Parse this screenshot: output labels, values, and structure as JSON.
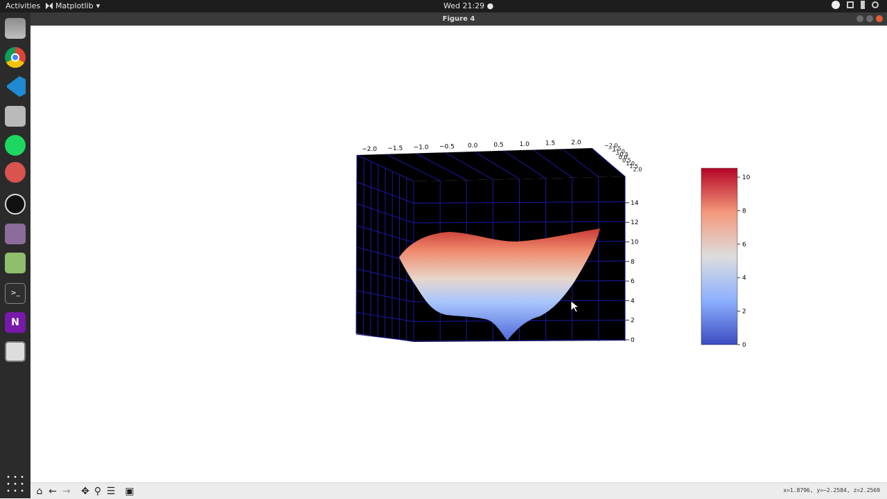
{
  "topbar": {
    "activities": "Activities",
    "app_name": "Matplotlib",
    "clock": "Wed 21:29 ●"
  },
  "window": {
    "title": "Figure 4",
    "coords": "x=1.8796, y=−2.2584, z=2.2569"
  },
  "dock": {
    "items": [
      "files-icon",
      "chrome-icon",
      "vscode-icon",
      "screenshot-icon",
      "spotify-icon",
      "todo-icon",
      "obs-icon",
      "webcam-icon",
      "image-viewer-icon",
      "terminal-icon",
      "onenote-icon",
      "matplotlib-icon"
    ],
    "grid_icon": "show-apps-icon"
  },
  "toolbar": {
    "buttons": [
      "home-icon",
      "back-arrow-icon",
      "forward-arrow-icon",
      "pan-icon",
      "zoom-icon",
      "configure-subplots-icon",
      "save-icon"
    ]
  },
  "chart_data": {
    "type": "surface-3d",
    "x_ticks": [
      "−2.0",
      "−1.5",
      "−1.0",
      "−0.5",
      "0.0",
      "0.5",
      "1.0",
      "1.5",
      "2.0"
    ],
    "y_ticks": [
      "−2.0",
      "−1.5",
      "−1.0",
      "−0.5",
      "0.0",
      "0.5",
      "1.0",
      "1.5",
      "2.0"
    ],
    "z_ticks": [
      "0",
      "2",
      "4",
      "6",
      "8",
      "10",
      "12",
      "14"
    ],
    "colorbar_ticks": [
      "0",
      "2",
      "4",
      "6",
      "8",
      "10"
    ],
    "colormap": "coolwarm",
    "colors": {
      "low": "#3b4cc0",
      "mid": "#dddddd",
      "high": "#b40426",
      "pane": "#000000",
      "grid": "#1a1aa8"
    }
  }
}
